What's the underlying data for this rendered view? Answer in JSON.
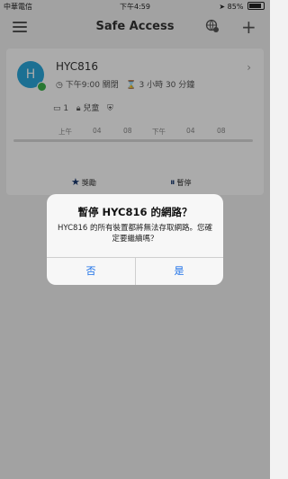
{
  "status_bar": {
    "carrier": "中華電信",
    "time": "下午4:59",
    "battery": "85%",
    "battery_level": 0.85
  },
  "header": {
    "title": "Safe Access",
    "menu_icon": "hamburger-icon",
    "right_icons": [
      "globe-settings-icon",
      "plus-icon"
    ]
  },
  "profile": {
    "avatar_letter": "H",
    "name": "HYC816",
    "schedule_time": "下午9:00 關閉",
    "remaining": "3 小時 30 分鐘",
    "device_count": "1",
    "category": "兒童",
    "timeline_labels": [
      "上午",
      "04",
      "08",
      "下午",
      "04",
      "08"
    ],
    "actions": {
      "reward": "獎勵",
      "pause": "暫停"
    }
  },
  "dialog": {
    "title": "暫停 HYC816 的網路？",
    "message": "HYC816 的所有裝置都將無法存取網路。您確定要繼續嗎？",
    "cancel": "否",
    "confirm": "是"
  },
  "colors": {
    "accent": "#1a6fe8",
    "avatar": "#2aa8dc",
    "online": "#3cb44b"
  }
}
